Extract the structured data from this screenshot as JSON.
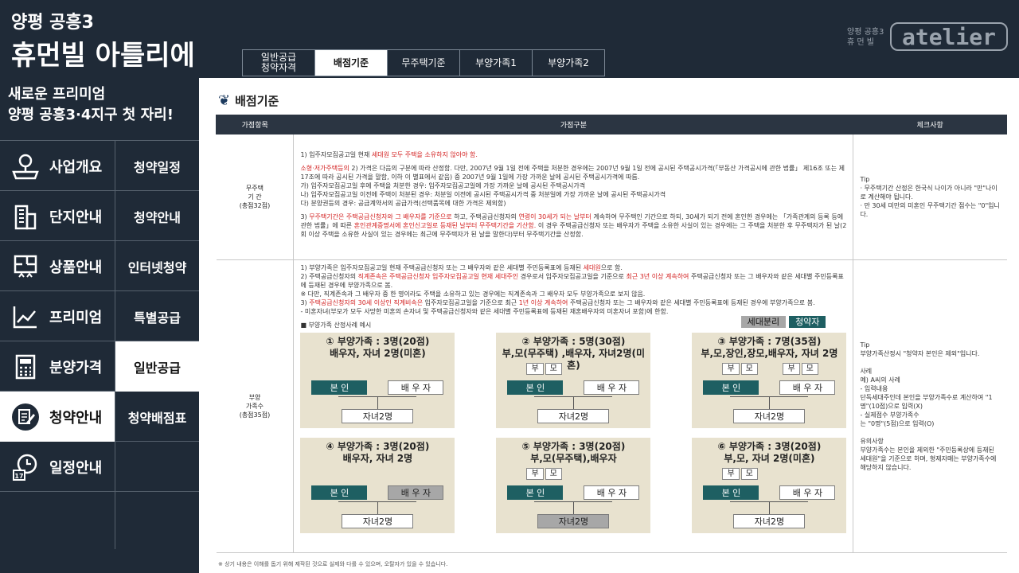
{
  "brand": {
    "line1": "양평 공흥3",
    "line2": "휴먼빌 아틀리에",
    "logo_small": "양평 공흥3\n휴 먼 빌",
    "logo_main": "atelier"
  },
  "tabs": [
    "일반공급\n청약자격",
    "배점기준",
    "무주택기준",
    "부양가족1",
    "부양가족2"
  ],
  "active_tab": 1,
  "side": {
    "headline1": "새로운 프리미엄",
    "headline2": "양평 공흥3·4지구 첫 자리!",
    "menu": [
      {
        "left": "사업개요",
        "right": "청약일정",
        "icon": "map-pin-icon"
      },
      {
        "left": "단지안내",
        "right": "청약안내",
        "icon": "building-icon"
      },
      {
        "left": "상품안내",
        "right": "인터넷청약",
        "icon": "floorplan-icon"
      },
      {
        "left": "프리미엄",
        "right": "특별공급",
        "icon": "chart-line-icon"
      },
      {
        "left": "분양가격",
        "right": "일반공급",
        "icon": "calculator-icon"
      },
      {
        "left": "청약안내",
        "right": "청약배점표",
        "icon": "edit-icon"
      },
      {
        "left": "일정안내",
        "right": "",
        "icon": "calendar-clock-icon"
      }
    ]
  },
  "content": {
    "title": "배점기준",
    "headers": [
      "가점항목",
      "가점구분",
      "체크사항"
    ],
    "row1": {
      "label1": "무주택",
      "label2": "기  간",
      "label3": "(총점32점)",
      "p1a": "1) 입주자모집공고일 현재 ",
      "p1b": "세대원 모두 주택을 소유하지 않아야 함.",
      "p2a": "소형·저가주택등의",
      "p2": "2) 가격은 다음의 구분에 따라 산정함. 다만, 2007년 9월 1일 전에 주택을 처분한 경우에는 2007년 9월 1일 전에 공시된 주택공시가격(「부동산 가격공시에 관한 법률」 제16조 또는 제17조에 따라 공시된 가격을 말함, 이하 이 별표에서 같음) 중 2007년 9월 1일에 가장 가까운 날에 공시된 주택공시가격에 따름.",
      "p2b": "가) 입주자모집공고일 후에 주택을 처분한 경우: 입주자모집공고일에 가장 가까운 날에 공시된 주택공시가격",
      "p2c": "나) 입주자모집공고일 이전에 주택이 처분된 경우: 처분일 이전에 공시된 주택공시가격 중 처분일에 가장 가까운 날에 공시된 주택공시가격",
      "p2d": "다) 분양권등의 경우: 공급계약서의 공급가격(선택품목에 대한 가격은 제외함)",
      "p3a": "3) ",
      "p3b": "무주택기간은 주택공급신청자와 그 배우자를 기준으로",
      "p3c": " 하고, 주택공급신청자의 ",
      "p3d": "연령이 30세가 되는 날부터",
      "p3e": " 계속하여 무주택인 기간으로 하되, 30세가 되기 전에 혼인한 경우에는 「가족관계의 등록 등에 관한 법률」에 따른 ",
      "p3f": "혼인관계증명서에 혼인신고일로 등재된 날부터 무주택기간을 기산함.",
      "p3g": " 이 경우 주택공급신청자 또는 배우자가 주택을 소유한 사실이 있는 경우에는 그 주택을 처분한 후 무주택자가 된 날(2회 이상 주택을 소유한 사실이 있는 경우에는 최근에 무주택자가 된 날을 말한다)부터 무주택기간을 산정함.",
      "tip1": "Tip",
      "tip2": "· 무주택기간 산정은 한국식 나이가 아니라 \"만\"나이로 계산해야 됩니다.",
      "tip3": "· 만 30세 미만의 미혼인 무주택기간 점수는 \"0\"입니다."
    },
    "row2": {
      "label1": "부양",
      "label2": "가족수",
      "label3": "(총점35점)",
      "q1a": "1) 부양가족은 입주자모집공고일 현재 주택공급신청자 또는 그 배우자와 같은 세대별 주민등록표에 등재된 ",
      "q1b": "세대원",
      "q1c": "으로 함.",
      "q2a": "2) 주택공급신청자의 ",
      "q2b": "직계존속은 주택공급신청자 입주자모집공고일 현재 세대주인",
      "q2c": " 경우로서 입주자모집공고일을 기준으로 ",
      "q2d": "최근 3년 이상 계속하여",
      "q2e": " 주택공급신청자 또는 그 배우자와 같은 세대별 주민등록표에 등재된 경우에 부양가족으로 봄.",
      "q2f": "※ 다만, 직계존속과 그 배우자 중 한 명이라도 주택을 소유하고 있는 경우에는 직계존속과 그 배우자 모두 부양가족으로 보지 않음.",
      "q3a": "3) ",
      "q3b": "주택공급신청자의 30세 이상인 직계비속은",
      "q3c": " 입주자모집공고일을 기준으로 최근 ",
      "q3d": "1년 이상 계속하여",
      "q3e": " 주택공급신청자 또는 그 배우자와 같은 세대별 주민등록표에 등재된 경우에 부양가족으로 봄.",
      "q4": "- 미혼자녀(부모가 모두 사망한 미혼의 손자녀 및 주택공급신청자와 같은 세대별 주민등록표에 등재된 재혼배우자의 미혼자녀 포함)에 한함.",
      "example_title": "■ 부양가족 산정사례 예시",
      "tag1": "세대분리",
      "tag2": "청약자",
      "tip": "Tip\n부양가족산정시 \"청약자 본인은 제외\"입니다.\n\n사례\n예) A씨의 사례\n- 입력내용\n단독세대주인데 본인을 부양가족수로 계산하여 \"1명\"(10점)으로 입력(X)\n- 실제점수 부양가족수\n는 \"0명\"(5점)으로  입력(O)\n\n유의사항\n부양가족수는 본인을 제외한 \"주민등록상에 등재된 세대원\"을 기준으로 하며, 형제자매는 부양가족수에 해당하지 않습니다."
    },
    "cards": [
      {
        "t1": "① 부양가족 : 3명(20점)",
        "t2": "배우자, 자녀 2명(미혼)",
        "parents": [],
        "extra": [],
        "me": "본  인",
        "sp": "배 우 자",
        "kid": "자녀2명",
        "sp_gray": false,
        "kid_gray": false
      },
      {
        "t1": "② 부양가족 : 5명(30점)",
        "t2": "부,모(무주택) ,배우자, 자녀2명(미혼)",
        "parents": [
          "부",
          "모"
        ],
        "extra": [],
        "me": "본  인",
        "sp": "배 우 자",
        "kid": "자녀2명",
        "sp_gray": false,
        "kid_gray": false
      },
      {
        "t1": "③ 부양가족 : 7명(35점)",
        "t2": "부,모,장인,장모,배우자, 자녀 2명",
        "parents": [
          "부",
          "모"
        ],
        "extra": [
          "부",
          "모"
        ],
        "me": "본  인",
        "sp": "배 우 자",
        "kid": "자녀2명",
        "sp_gray": false,
        "kid_gray": false
      },
      {
        "t1": "④ 부양가족 : 3명(20점)",
        "t2": "배우자, 자녀 2명",
        "parents": [],
        "extra": [],
        "me": "본  인",
        "sp": "배 우 자",
        "kid": "자녀2명",
        "sp_gray": true,
        "kid_gray": false
      },
      {
        "t1": "⑤ 부양가족 : 3명(20점)",
        "t2": "부,모(무주택),배우자",
        "parents": [
          "부",
          "모"
        ],
        "extra": [],
        "me": "본  인",
        "sp": "배 우 자",
        "kid": "자녀2명",
        "sp_gray": false,
        "kid_gray": true
      },
      {
        "t1": "⑥ 부양가족 : 3명(20점)",
        "t2": "부,모, 자녀 2명(미혼)",
        "parents": [
          "부",
          "모"
        ],
        "extra": [],
        "me": "본  인",
        "sp": "배 우 자",
        "kid": "자녀2명",
        "sp_gray": false,
        "kid_gray": false
      }
    ],
    "footnote": "※ 상기 내용은 이해를 돕기 위해 제작된 것으로 실제와 다를 수 있으며, 오탈자가 있을 수 있습니다."
  },
  "colors": {
    "navy": "#1f2a37",
    "teal": "#1e5f62",
    "beige": "#e8e2cf",
    "red": "#d32020"
  }
}
